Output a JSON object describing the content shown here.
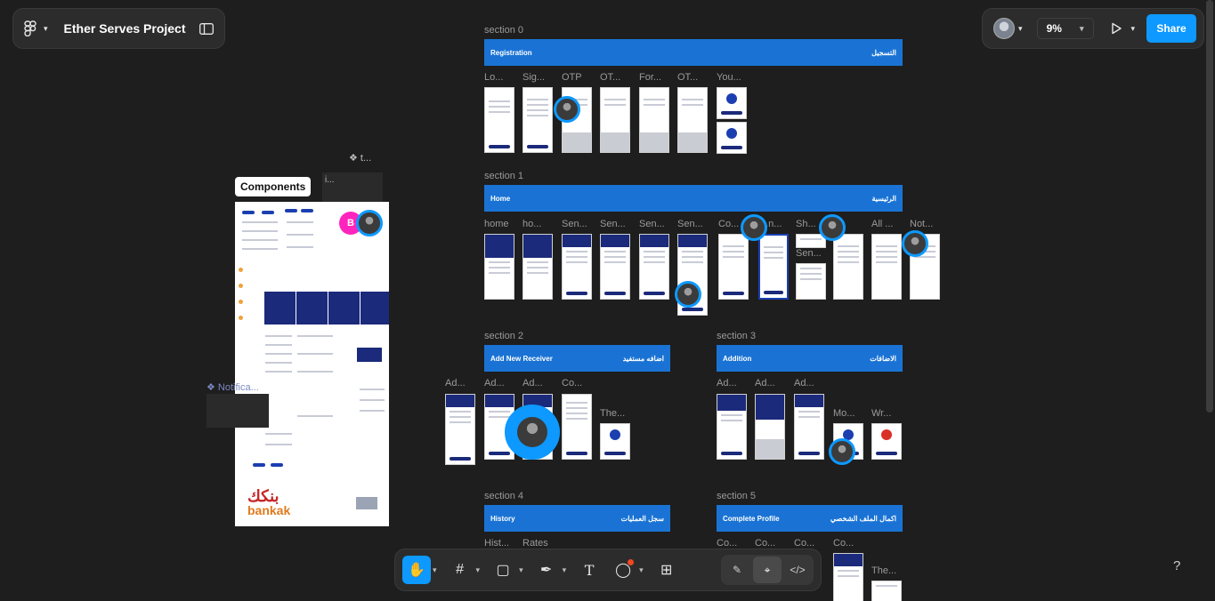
{
  "file": {
    "title": "Ether Serves Project"
  },
  "toolbar_top": {
    "zoom": "9%",
    "share_label": "Share"
  },
  "sections": [
    {
      "label": "section 0",
      "banner_en": "Registration",
      "banner_ar": "التسجيل",
      "screens": [
        "Lo...",
        "Sig...",
        "OTP",
        "OT...",
        "For...",
        "OT...",
        "You..."
      ]
    },
    {
      "label": "section 1",
      "banner_en": "Home",
      "banner_ar": "الرئيسية",
      "screens": [
        "home",
        "ho...",
        "Sen...",
        "Sen...",
        "Sen...",
        "Sen...",
        "Co...",
        "...n...",
        "Sh...",
        "All ...",
        "Not..."
      ],
      "extra": "Sen..."
    },
    {
      "label": "section 2",
      "banner_en": "Add  New Receiver",
      "banner_ar": "اضافه مستفيد",
      "screens": [
        "Ad...",
        "Ad...",
        "Ad...",
        "Co...",
        "The..."
      ]
    },
    {
      "label": "section 3",
      "banner_en": "Addition",
      "banner_ar": "الاضافات",
      "screens": [
        "Ad...",
        "Ad...",
        "Ad...",
        "Mo...",
        "Wr..."
      ]
    },
    {
      "label": "section 4",
      "banner_en": "History",
      "banner_ar": "سجل العمليات",
      "screens": [
        "Hist...",
        "Rates"
      ]
    },
    {
      "label": "section 5",
      "banner_en": "Complete  Profile",
      "banner_ar": "اكمال الملف الشخصي",
      "screens": [
        "Co...",
        "Co...",
        "Co...",
        "Co...",
        "The..."
      ]
    }
  ],
  "components": {
    "tag": "Components",
    "small_label": "i...",
    "t_label": "t...",
    "notif_label": "Notifica...",
    "badge_initial": "B",
    "brand_ar": "بنكك",
    "brand_en": "bankak"
  },
  "tools": [
    "hand",
    "frame",
    "rectangle",
    "pen",
    "text",
    "comment",
    "actions"
  ],
  "modes": [
    "draw",
    "design",
    "dev"
  ],
  "help": "?"
}
